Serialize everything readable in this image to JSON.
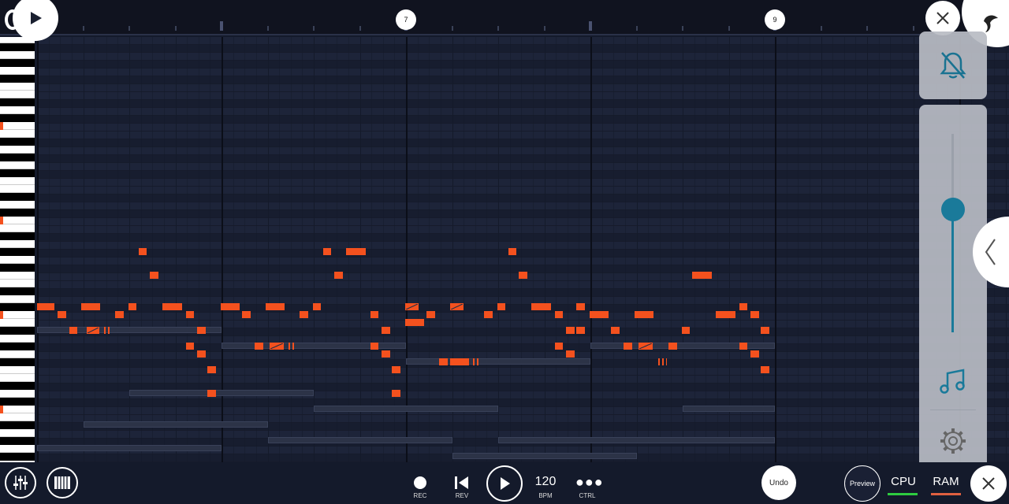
{
  "ruler": {
    "markers": [
      {
        "label": "7",
        "bar": 7
      },
      {
        "label": "9",
        "bar": 9
      }
    ]
  },
  "colors": {
    "note": "#f4511e",
    "accent": "#1a7a9a",
    "cpu": "#2ecc40",
    "ram": "#e06040",
    "grid": "#1b2236"
  },
  "piano_roll": {
    "notes": [
      {
        "row": 27,
        "start": 8.8,
        "len": 0.7
      },
      {
        "row": 30,
        "start": 9.8,
        "len": 0.7
      },
      {
        "row": 34,
        "start": 0,
        "len": 1.5
      },
      {
        "row": 35,
        "start": 1.8,
        "len": 0.7
      },
      {
        "row": 37,
        "start": 2.8,
        "len": 0.7
      },
      {
        "row": 34,
        "start": 3.8,
        "len": 1.7
      },
      {
        "row": 37,
        "start": 4.3,
        "len": 1.1,
        "style": "hatch"
      },
      {
        "row": 37,
        "start": 5.8,
        "len": 0.7,
        "style": "tiny"
      },
      {
        "row": 35,
        "start": 6.8,
        "len": 0.7
      },
      {
        "row": 34,
        "start": 7.9,
        "len": 0.7
      },
      {
        "row": 34,
        "start": 10.9,
        "len": 1.7
      },
      {
        "row": 39,
        "start": 12.9,
        "len": 0.7
      },
      {
        "row": 35,
        "start": 12.9,
        "len": 0.7
      },
      {
        "row": 37,
        "start": 13.9,
        "len": 0.7
      },
      {
        "row": 40,
        "start": 13.9,
        "len": 0.7
      },
      {
        "row": 42,
        "start": 14.8,
        "len": 0.7
      },
      {
        "row": 45,
        "start": 14.8,
        "len": 0.7
      },
      {
        "row": 34,
        "start": 15.9,
        "len": 1.7
      },
      {
        "row": 35,
        "start": 17.8,
        "len": 0.7
      },
      {
        "row": 39,
        "start": 18.9,
        "len": 0.7
      },
      {
        "row": 34,
        "start": 19.8,
        "len": 1.7
      },
      {
        "row": 39,
        "start": 20.2,
        "len": 1.2,
        "style": "hatch"
      },
      {
        "row": 39,
        "start": 21.8,
        "len": 0.7,
        "style": "tiny"
      },
      {
        "row": 35,
        "start": 22.8,
        "len": 0.7
      },
      {
        "row": 34,
        "start": 23.9,
        "len": 0.7
      },
      {
        "row": 27,
        "start": 24.8,
        "len": 0.7
      },
      {
        "row": 30,
        "start": 25.8,
        "len": 0.7
      },
      {
        "row": 27,
        "start": 26.8,
        "len": 1.7
      },
      {
        "row": 35,
        "start": 28.9,
        "len": 0.7
      },
      {
        "row": 39,
        "start": 28.9,
        "len": 0.7
      },
      {
        "row": 37,
        "start": 29.9,
        "len": 0.7
      },
      {
        "row": 40,
        "start": 29.9,
        "len": 0.7
      },
      {
        "row": 42,
        "start": 30.8,
        "len": 0.7
      },
      {
        "row": 45,
        "start": 30.8,
        "len": 0.7
      },
      {
        "row": 34,
        "start": 31.9,
        "len": 1.2,
        "style": "hatch"
      },
      {
        "row": 36,
        "start": 31.9,
        "len": 1.7
      },
      {
        "row": 35,
        "start": 33.8,
        "len": 0.7
      },
      {
        "row": 41,
        "start": 34.9,
        "len": 0.7
      },
      {
        "row": 41,
        "start": 35.8,
        "len": 1.7
      },
      {
        "row": 34,
        "start": 35.8,
        "len": 1.2,
        "style": "hatch"
      },
      {
        "row": 41,
        "start": 37.8,
        "len": 0.7,
        "style": "tiny"
      },
      {
        "row": 35,
        "start": 38.8,
        "len": 0.7
      },
      {
        "row": 34,
        "start": 39.9,
        "len": 0.7
      },
      {
        "row": 27,
        "start": 40.9,
        "len": 0.7
      },
      {
        "row": 30,
        "start": 41.8,
        "len": 0.7
      },
      {
        "row": 34,
        "start": 42.9,
        "len": 1.7
      },
      {
        "row": 35,
        "start": 44.9,
        "len": 0.7
      },
      {
        "row": 39,
        "start": 44.9,
        "len": 0.7
      },
      {
        "row": 37,
        "start": 45.9,
        "len": 0.7
      },
      {
        "row": 40,
        "start": 45.9,
        "len": 0.7
      },
      {
        "row": 34,
        "start": 46.8,
        "len": 0.7
      },
      {
        "row": 37,
        "start": 46.8,
        "len": 0.7
      },
      {
        "row": 35,
        "start": 47.9,
        "len": 1.7
      },
      {
        "row": 37,
        "start": 49.8,
        "len": 0.7
      },
      {
        "row": 39,
        "start": 50.9,
        "len": 0.7
      },
      {
        "row": 35,
        "start": 51.8,
        "len": 1.7
      },
      {
        "row": 39,
        "start": 52.2,
        "len": 1.2,
        "style": "hatch"
      },
      {
        "row": 41,
        "start": 53.9,
        "len": 0.7,
        "style": "tiny"
      },
      {
        "row": 39,
        "start": 54.8,
        "len": 0.7
      },
      {
        "row": 37,
        "start": 55.9,
        "len": 0.7
      },
      {
        "row": 30,
        "start": 56.8,
        "len": 1.7
      },
      {
        "row": 35,
        "start": 58.9,
        "len": 1.7
      },
      {
        "row": 34,
        "start": 60.9,
        "len": 0.7
      },
      {
        "row": 39,
        "start": 60.9,
        "len": 0.7
      },
      {
        "row": 35,
        "start": 61.9,
        "len": 0.7
      },
      {
        "row": 40,
        "start": 61.9,
        "len": 0.7
      },
      {
        "row": 37,
        "start": 62.8,
        "len": 0.7
      },
      {
        "row": 42,
        "start": 62.8,
        "len": 0.7
      }
    ],
    "ghost_notes": [
      {
        "row": 37,
        "start": 0,
        "len": 16
      },
      {
        "row": 39,
        "start": 16,
        "len": 16
      },
      {
        "row": 41,
        "start": 32,
        "len": 16
      },
      {
        "row": 39,
        "start": 48,
        "len": 16
      },
      {
        "row": 45,
        "start": 8,
        "len": 16
      },
      {
        "row": 47,
        "start": 24,
        "len": 16
      },
      {
        "row": 47,
        "start": 56,
        "len": 8
      },
      {
        "row": 49,
        "start": 4,
        "len": 16
      },
      {
        "row": 51,
        "start": 20,
        "len": 16
      },
      {
        "row": 51,
        "start": 40,
        "len": 24
      },
      {
        "row": 52,
        "start": 0,
        "len": 16
      },
      {
        "row": 53,
        "start": 36,
        "len": 16
      }
    ]
  },
  "right_panel": {
    "volume": 0.62
  },
  "transport": {
    "rec": "REC",
    "rev": "REV",
    "bpm_value": "120",
    "bpm": "BPM",
    "ctrl": "CTRL",
    "undo": "Undo",
    "preview": "Preview",
    "cpu": "CPU",
    "ram": "RAM"
  }
}
